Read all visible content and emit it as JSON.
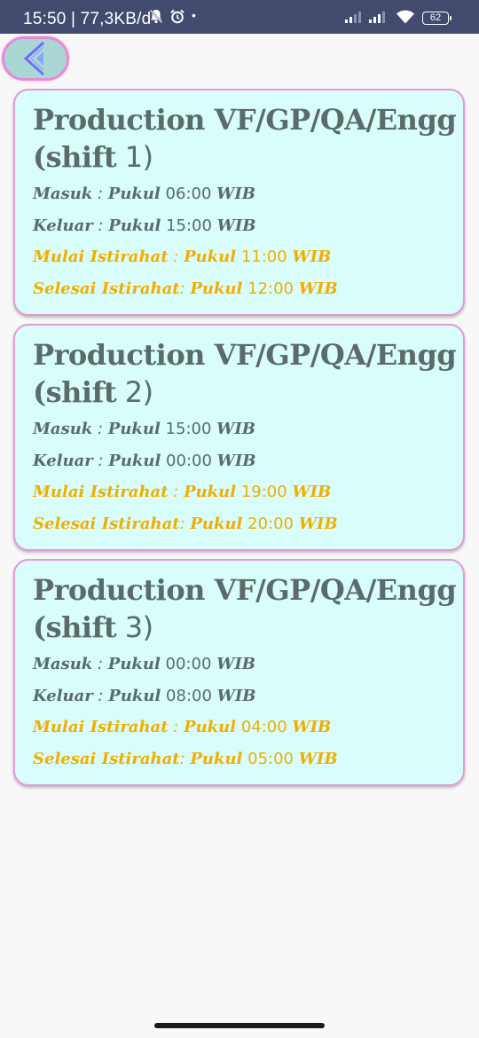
{
  "status": {
    "time": "15:50 | 77,3KB/d",
    "battery": "62"
  },
  "header": {
    "back_button": "back-chevron-icon"
  },
  "shifts": [
    {
      "title": "Production VF/GP/QA/Engg",
      "shift_prefix": "(shift",
      "shift_number": " 1)",
      "masuk_label": "Masuk",
      "masuk_sep": " :  ",
      "masuk_pukul": "Pukul",
      "masuk_time": " 06:00 ",
      "masuk_wib": "WIB",
      "keluar_label": "Keluar",
      "keluar_sep": " :  ",
      "keluar_pukul": "Pukul",
      "keluar_time": " 15:00 ",
      "keluar_wib": "WIB",
      "mulai_label": "Mulai Istirahat",
      "mulai_sep": " :  ",
      "mulai_pukul": "Pukul",
      "mulai_time": " 11:00 ",
      "mulai_wib": "WIB",
      "selesai_label": "Selesai Istirahat",
      "selesai_sep": ":  ",
      "selesai_pukul": "Pukul",
      "selesai_time": " 12:00 ",
      "selesai_wib": "WIB"
    },
    {
      "title": "Production VF/GP/QA/Engg",
      "shift_prefix": "(shift",
      "shift_number": " 2)",
      "masuk_label": "Masuk",
      "masuk_sep": " :  ",
      "masuk_pukul": "Pukul",
      "masuk_time": " 15:00 ",
      "masuk_wib": "WIB",
      "keluar_label": "Keluar",
      "keluar_sep": " :  ",
      "keluar_pukul": "Pukul",
      "keluar_time": " 00:00 ",
      "keluar_wib": "WIB",
      "mulai_label": "Mulai Istirahat",
      "mulai_sep": " :  ",
      "mulai_pukul": "Pukul",
      "mulai_time": " 19:00 ",
      "mulai_wib": "WIB",
      "selesai_label": "Selesai Istirahat",
      "selesai_sep": ":  ",
      "selesai_pukul": "Pukul",
      "selesai_time": " 20:00 ",
      "selesai_wib": "WIB"
    },
    {
      "title": "Production VF/GP/QA/Engg",
      "shift_prefix": "(shift",
      "shift_number": " 3)",
      "masuk_label": "Masuk",
      "masuk_sep": " :  ",
      "masuk_pukul": "Pukul",
      "masuk_time": " 00:00 ",
      "masuk_wib": "WIB",
      "keluar_label": "Keluar",
      "keluar_sep": " :  ",
      "keluar_pukul": "Pukul",
      "keluar_time": " 08:00 ",
      "keluar_wib": "WIB",
      "mulai_label": "Mulai Istirahat",
      "mulai_sep": " :  ",
      "mulai_pukul": "Pukul",
      "mulai_time": " 04:00 ",
      "mulai_wib": "WIB",
      "selesai_label": "Selesai Istirahat",
      "selesai_sep": ":  ",
      "selesai_pukul": "Pukul",
      "selesai_time": " 05:00 ",
      "selesai_wib": "WIB"
    }
  ],
  "colors": {
    "status_bar": "#424a6e",
    "card_bg": "#d8fdfb",
    "card_border": "#e39ad8",
    "text_main": "#5a6b68",
    "text_accent": "#f1ae00",
    "back_button_bg": "#a9d8d4",
    "back_button_border": "#e68bd8"
  }
}
